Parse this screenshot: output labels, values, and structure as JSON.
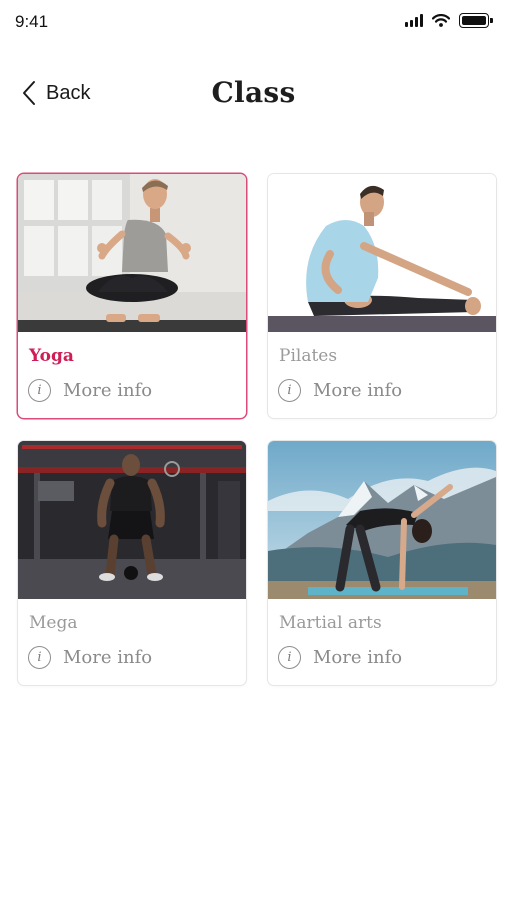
{
  "status_bar": {
    "time": "9:41"
  },
  "header": {
    "back_label": "Back",
    "title": "Class"
  },
  "classes": [
    {
      "name": "Yoga",
      "more_info": "More info",
      "selected": true,
      "photo": "man-meditating-yoga"
    },
    {
      "name": "Pilates",
      "more_info": "More info",
      "selected": false,
      "photo": "man-stretching-pilates"
    },
    {
      "name": "Mega",
      "more_info": "More info",
      "selected": false,
      "photo": "man-gym-kettlebell"
    },
    {
      "name": "Martial arts",
      "more_info": "More info",
      "selected": false,
      "photo": "woman-mountain-stretch"
    }
  ],
  "colors": {
    "accent": "#cf1d56",
    "accent_border": "#d94c79",
    "muted_text": "#9a9a9a"
  },
  "icons": {
    "back": "chevron-left-icon",
    "info": "info-icon",
    "signal": "signal-icon",
    "wifi": "wifi-icon",
    "battery": "battery-icon"
  }
}
